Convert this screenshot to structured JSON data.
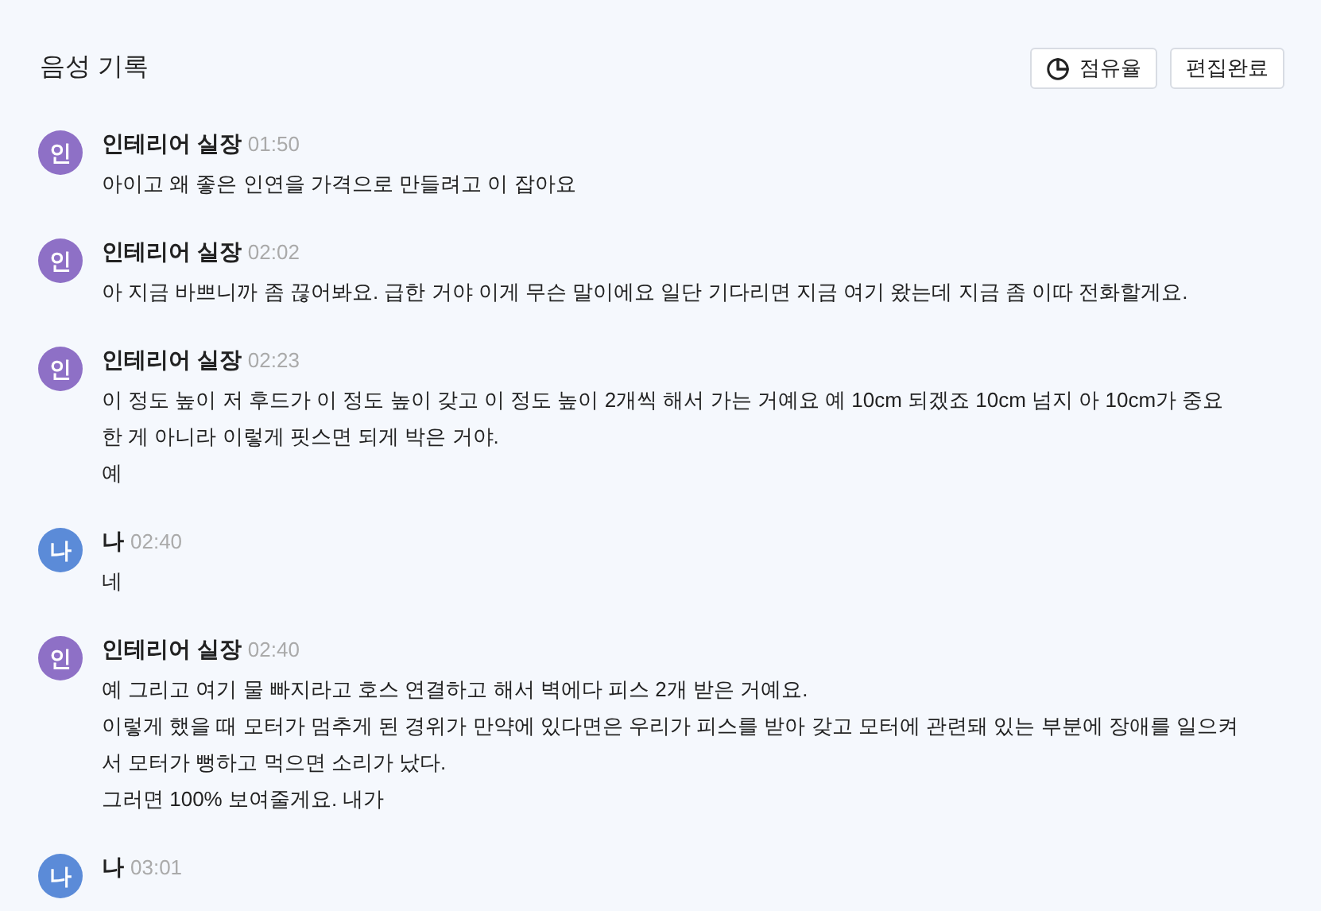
{
  "title": "음성 기록",
  "buttons": [
    {
      "kind": "share",
      "label": "점유율"
    },
    {
      "kind": "plain",
      "label": "편집완료"
    }
  ],
  "messages": [
    {
      "avatar": "인",
      "color": "#8e70c6",
      "speaker": "인테리어 실장",
      "time": "01:50",
      "lines": [
        "아이고 왜 좋은 인연을 가격으로 만들려고 이 잡아요"
      ]
    },
    {
      "avatar": "인",
      "color": "#8e70c6",
      "speaker": "인테리어 실장",
      "time": "02:02",
      "lines": [
        "아 지금 바쁘니까 좀 끊어봐요. 급한 거야 이게 무슨 말이에요 일단 기다리면 지금 여기 왔는데 지금 좀 이따 전화할게요."
      ]
    },
    {
      "avatar": "인",
      "color": "#8e70c6",
      "speaker": "인테리어 실장",
      "time": "02:23",
      "lines": [
        "이 정도 높이 저 후드가 이 정도 높이 갖고 이 정도 높이 2개씩 해서 가는 거예요 예 10cm 되겠죠 10cm 넘지 아 10cm가 중요한 게 아니라 이렇게 핏스면 되게 박은 거야.",
        "예"
      ]
    },
    {
      "avatar": "나",
      "color": "#5b8bd8",
      "speaker": "나",
      "time": "02:40",
      "lines": [
        "네"
      ]
    },
    {
      "avatar": "인",
      "color": "#8e70c6",
      "speaker": "인테리어 실장",
      "time": "02:40",
      "lines": [
        "예 그리고 여기 물 빠지라고 호스 연결하고 해서 벽에다 피스 2개 받은 거예요.",
        "이렇게 했을 때 모터가 멈추게 된 경위가 만약에 있다면은 우리가 피스를 받아 갖고 모터에 관련돼 있는 부분에 장애를 일으켜서 모터가 뻥하고 먹으면 소리가 났다.",
        "그러면 100% 보여줄게요. 내가"
      ]
    },
    {
      "avatar": "나",
      "color": "#5b8bd8",
      "speaker": "나",
      "time": "03:01"
    }
  ]
}
